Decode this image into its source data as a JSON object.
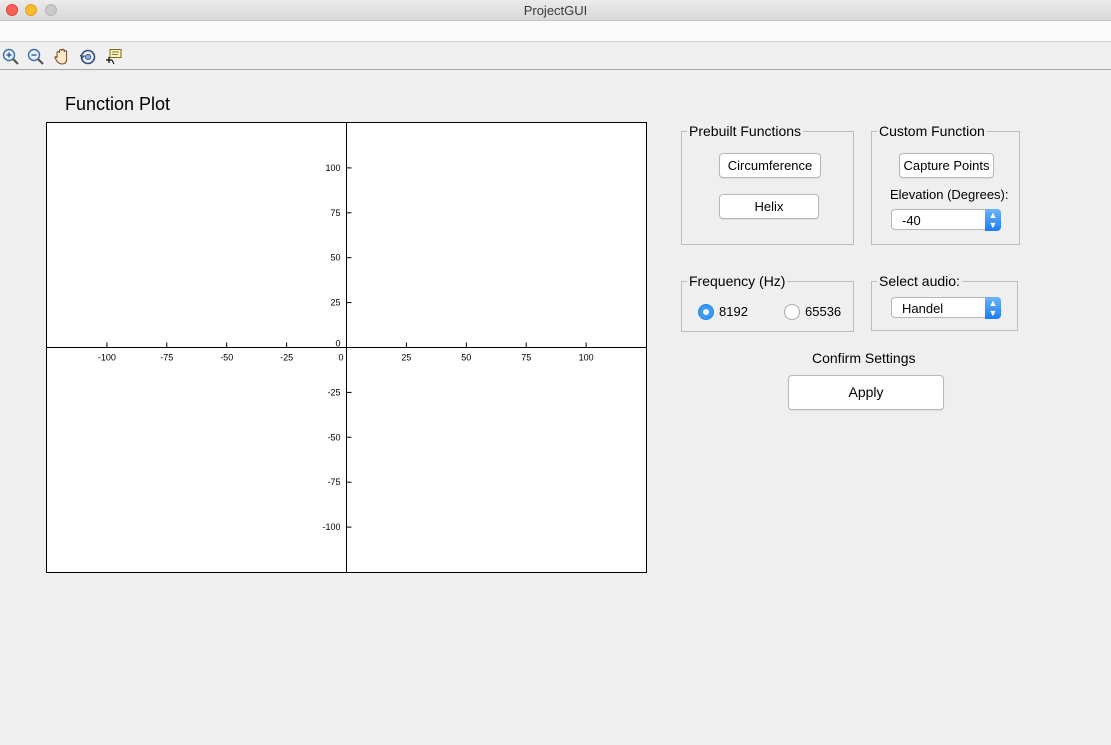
{
  "window": {
    "title": "ProjectGUI"
  },
  "toolbar": {
    "tools": [
      {
        "name": "zoom-in-icon"
      },
      {
        "name": "zoom-out-icon"
      },
      {
        "name": "pan-hand-icon"
      },
      {
        "name": "rotate-3d-icon"
      },
      {
        "name": "data-cursor-icon"
      }
    ]
  },
  "plot_panel": {
    "title": "Function Plot"
  },
  "chart_data": {
    "type": "line",
    "title": "",
    "xlabel": "",
    "ylabel": "",
    "xlim": [
      -125,
      125
    ],
    "ylim": [
      -125,
      125
    ],
    "xticks": [
      -100,
      -75,
      -50,
      -25,
      0,
      25,
      50,
      75,
      100
    ],
    "yticks": [
      100,
      75,
      50,
      25,
      0,
      -25,
      -50,
      -75,
      -100
    ],
    "series": [],
    "grid": false,
    "axis_location": "origin"
  },
  "prebuilt": {
    "title": "Prebuilt Functions",
    "circumference_label": "Circumference",
    "helix_label": "Helix"
  },
  "custom": {
    "title": "Custom Function",
    "capture_label": "Capture Points",
    "elevation_label": "Elevation (Degrees):",
    "elevation_value": "-40"
  },
  "frequency": {
    "title": "Frequency (Hz)",
    "options": [
      {
        "label": "8192",
        "selected": true
      },
      {
        "label": "65536",
        "selected": false
      }
    ]
  },
  "audio": {
    "title": "Select audio:",
    "value": "Handel"
  },
  "confirm": {
    "title": "Confirm Settings",
    "apply_label": "Apply"
  },
  "colors": {
    "accent": "#3b99fc",
    "close": "#fc5f57",
    "minimize": "#fdbc2e"
  }
}
